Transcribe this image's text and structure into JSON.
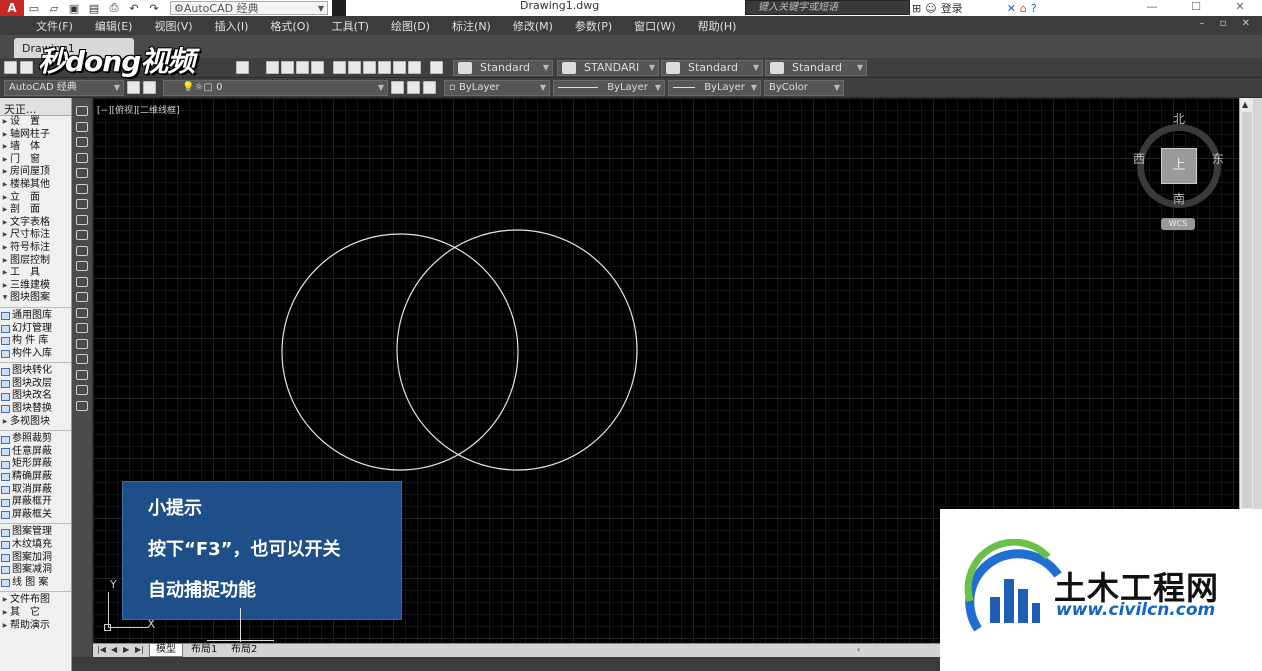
{
  "titlebar": {
    "app_logo": "A",
    "workspace": "AutoCAD 经典",
    "doc_title": "Drawing1.dwg",
    "search_placeholder": "键入关键字或短语",
    "login": "登录",
    "controls": [
      "—",
      "☐",
      "✕"
    ]
  },
  "menu": [
    "文件(F)",
    "编辑(E)",
    "视图(V)",
    "插入(I)",
    "格式(O)",
    "工具(T)",
    "绘图(D)",
    "标注(N)",
    "修改(M)",
    "参数(P)",
    "窗口(W)",
    "帮助(H)"
  ],
  "tabs": {
    "file_tab": "Drawing1"
  },
  "watermark": "秒dong视频",
  "styles": {
    "text_style": "Standard",
    "dim_style": "STANDARI",
    "table_style": "Standard",
    "multileader_style": "Standard"
  },
  "layers": {
    "workspace": "AutoCAD 经典",
    "current_layer": "0",
    "color": "ByLayer",
    "linetype": "ByLayer",
    "lineweight": "ByLayer",
    "plot_style": "ByColor"
  },
  "palette": {
    "title": "天正...",
    "items": [
      {
        "label": "设　置",
        "kind": "arrow"
      },
      {
        "label": "轴网柱子",
        "kind": "arrow"
      },
      {
        "label": "墙　体",
        "kind": "arrow"
      },
      {
        "label": "门　窗",
        "kind": "arrow"
      },
      {
        "label": "房间屋顶",
        "kind": "arrow"
      },
      {
        "label": "楼梯其他",
        "kind": "arrow"
      },
      {
        "label": "立　面",
        "kind": "arrow"
      },
      {
        "label": "剖　面",
        "kind": "arrow"
      },
      {
        "label": "文字表格",
        "kind": "arrow"
      },
      {
        "label": "尺寸标注",
        "kind": "arrow"
      },
      {
        "label": "符号标注",
        "kind": "arrow"
      },
      {
        "label": "图层控制",
        "kind": "arrow"
      },
      {
        "label": "工　具",
        "kind": "arrow"
      },
      {
        "label": "三维建模",
        "kind": "arrow"
      },
      {
        "label": "图块图案",
        "kind": "open"
      },
      {
        "label": "通用图库",
        "kind": "icon"
      },
      {
        "label": "幻灯管理",
        "kind": "icon"
      },
      {
        "label": "构 件 库",
        "kind": "icon"
      },
      {
        "label": "构件入库",
        "kind": "icon"
      },
      {
        "label": "图块转化",
        "kind": "icon"
      },
      {
        "label": "图块改层",
        "kind": "icon"
      },
      {
        "label": "图块改名",
        "kind": "icon"
      },
      {
        "label": "图块替换",
        "kind": "icon"
      },
      {
        "label": "多视图块",
        "kind": "arrow"
      },
      {
        "label": "参照裁剪",
        "kind": "icon"
      },
      {
        "label": "任意屏蔽",
        "kind": "icon"
      },
      {
        "label": "矩形屏蔽",
        "kind": "icon"
      },
      {
        "label": "精确屏蔽",
        "kind": "icon"
      },
      {
        "label": "取消屏蔽",
        "kind": "icon"
      },
      {
        "label": "屏蔽框开",
        "kind": "icon"
      },
      {
        "label": "屏蔽框关",
        "kind": "icon"
      },
      {
        "label": "图案管理",
        "kind": "icon"
      },
      {
        "label": "木纹填充",
        "kind": "icon"
      },
      {
        "label": "图案加洞",
        "kind": "icon"
      },
      {
        "label": "图案减洞",
        "kind": "icon"
      },
      {
        "label": "线 图 案",
        "kind": "icon"
      },
      {
        "label": "文件布图",
        "kind": "arrow"
      },
      {
        "label": "其　它",
        "kind": "arrow"
      },
      {
        "label": "帮助演示",
        "kind": "arrow"
      }
    ]
  },
  "canvas": {
    "view_label": "[−][俯视][二维线框]"
  },
  "viewcube": {
    "north": "北",
    "south": "南",
    "east": "东",
    "west": "西",
    "face": "上",
    "wcs": "WCS"
  },
  "ucs": {
    "x": "X",
    "y": "Y"
  },
  "tip": {
    "title": "小提示",
    "line1": "按下“F3”，也可以开关",
    "line2": "自动捕捉功能"
  },
  "layout_tabs": [
    "模型",
    "布局1",
    "布局2"
  ],
  "logo": {
    "name": "土木工程网",
    "url": "www.civilcn.com"
  }
}
